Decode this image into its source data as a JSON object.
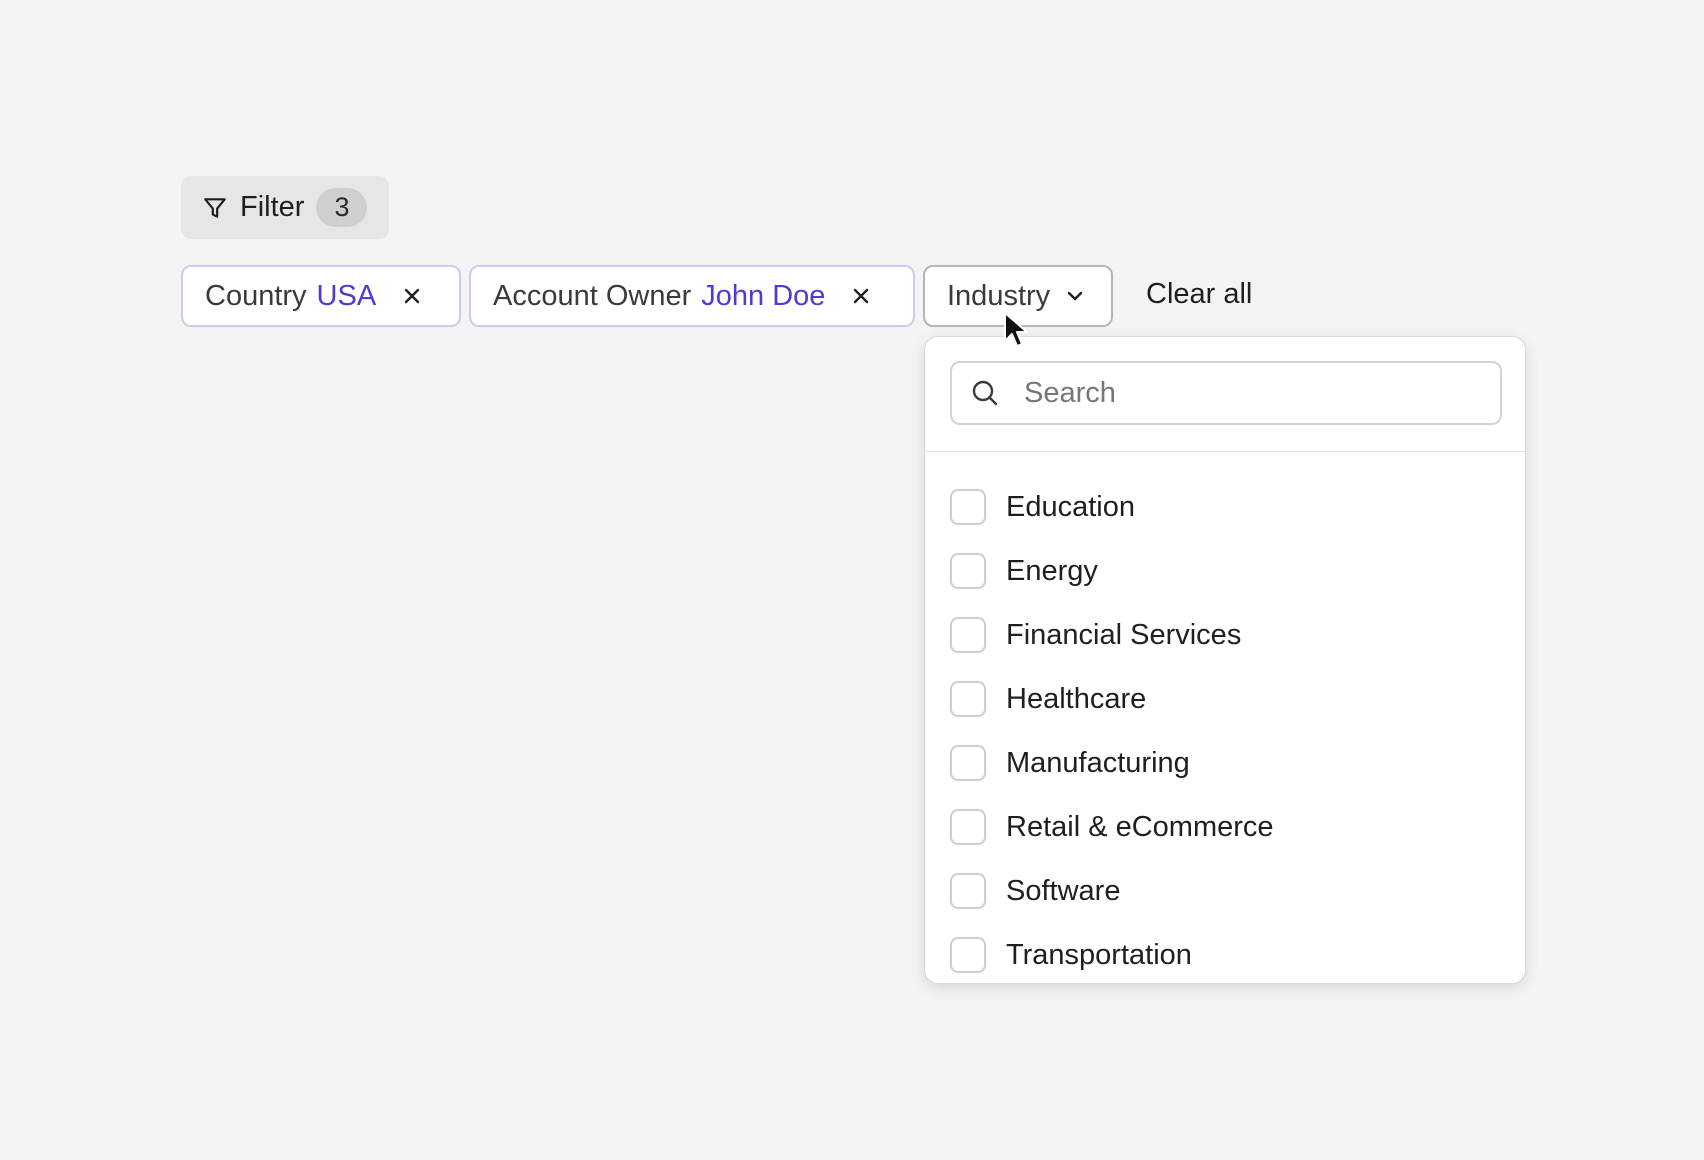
{
  "filter_button": {
    "label": "Filter",
    "count": "3",
    "icon": "funnel-icon"
  },
  "chips": [
    {
      "label": "Country",
      "value": "USA"
    },
    {
      "label": "Account Owner",
      "value": "John Doe"
    }
  ],
  "industry_dropdown": {
    "label": "Industry",
    "search_placeholder": "Search",
    "options": [
      "Education",
      "Energy",
      "Financial Services",
      "Healthcare",
      "Manufacturing",
      "Retail & eCommerce",
      "Software",
      "Transportation"
    ]
  },
  "clear_all_label": "Clear all",
  "colors": {
    "accent": "#4f3ad8",
    "chip_border": "#cfc9ef",
    "background": "#f4f4f4"
  }
}
